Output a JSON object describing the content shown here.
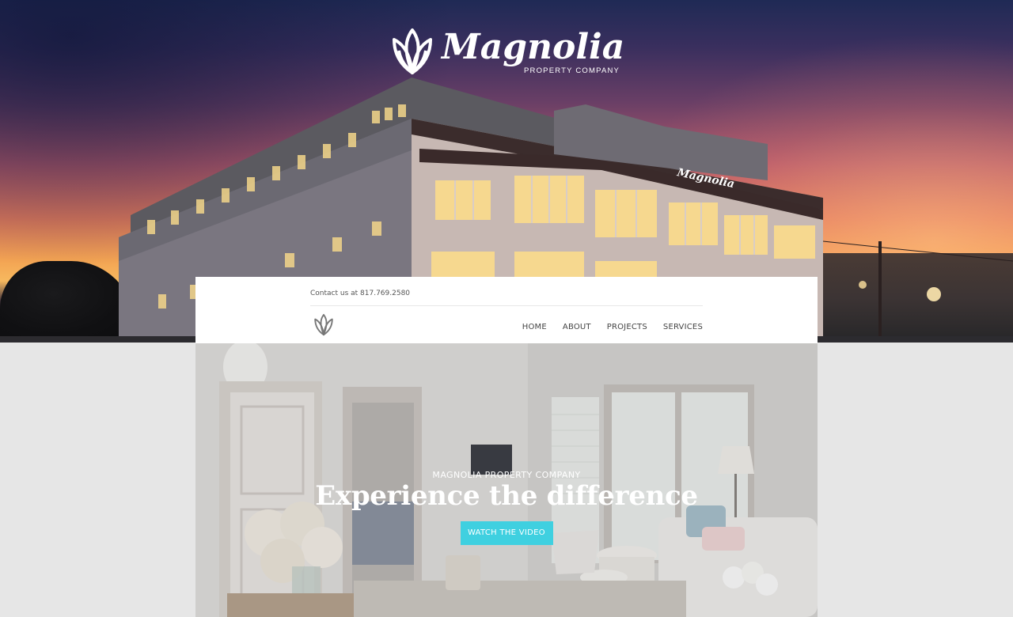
{
  "brand": {
    "name": "Magnolia",
    "tagline": "PROPERTY COMPANY"
  },
  "header": {
    "contact": "Contact us at 817.769.2580"
  },
  "nav": {
    "items": [
      {
        "label": "HOME"
      },
      {
        "label": "ABOUT"
      },
      {
        "label": "PROJECTS"
      },
      {
        "label": "SERVICES"
      }
    ]
  },
  "hero": {
    "eyebrow": "MAGNOLIA PROPERTY COMPANY",
    "headline": "Experience the difference",
    "cta_label": "WATCH THE VIDEO"
  },
  "colors": {
    "accent": "#3fd0e0",
    "page_bg": "#e6e6e6",
    "nav_text": "#444444"
  },
  "icons": {
    "logo": "magnolia-lotus-icon"
  }
}
